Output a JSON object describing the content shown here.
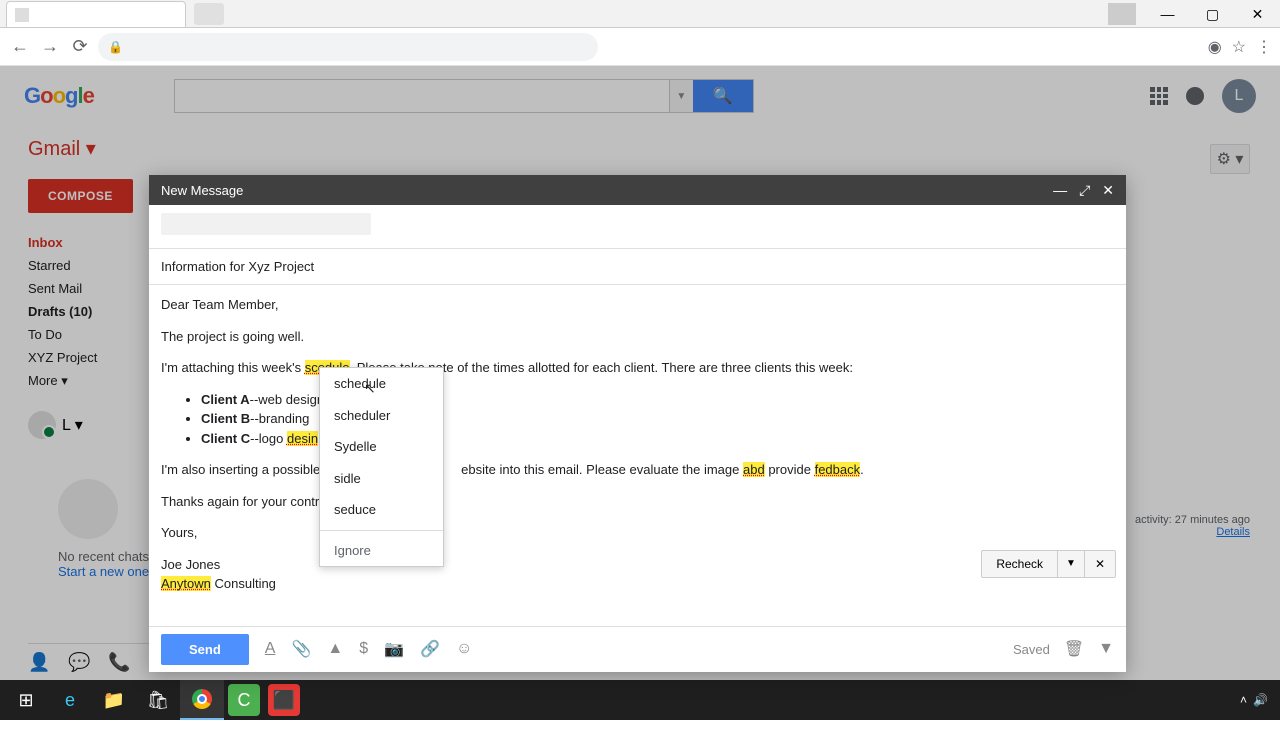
{
  "browser": {
    "window_controls": {
      "minimize": "—",
      "maximize": "▢",
      "close": "✕"
    }
  },
  "google": {
    "logo": "Google",
    "apps": "Apps",
    "avatar_letter": "L"
  },
  "gmail": {
    "title": "Gmail ▾",
    "compose": "COMPOSE",
    "nav": [
      "Inbox",
      "Starred",
      "Sent Mail",
      "Drafts (10)",
      "To Do",
      "XYZ Project",
      "More ▾"
    ],
    "user_letter": "L ▾",
    "hangouts_no_recent": "No recent chats",
    "hangouts_start": "Start a new one",
    "activity": "activity: 27 minutes ago",
    "details": "Details"
  },
  "compose": {
    "title": "New Message",
    "subject": "Information for Xyz Project",
    "body": {
      "greeting": "Dear Team Member,",
      "p1": "The project is going well.",
      "p2a": "I'm attaching this week's ",
      "p2_hl": "scedule",
      "p2b": ". Please take note of the times allotted for each client. There are three clients this week:",
      "clients": [
        {
          "name": "Client A",
          "desc": "--web design"
        },
        {
          "name": "Client B",
          "desc": "--branding"
        },
        {
          "name": "Client C",
          "desc": "--logo ",
          "hl": "desin"
        }
      ],
      "p3a": "I'm also inserting a possible ",
      "p3_gap": "                                      ",
      "p3b": "ebsite into this email. Please evaluate the image ",
      "p3_hl1": "abd",
      "p3c": " provide ",
      "p3_hl2": "fedback",
      "p3d": ".",
      "p4": "Thanks again for your contri",
      "p5": "Yours,",
      "sig1": "Joe Jones",
      "sig2_hl": "Anytown",
      "sig2b": " Consulting"
    },
    "spellcheck": {
      "suggestions": [
        "schedule",
        "scheduler",
        "Sydelle",
        "sidle",
        "seduce"
      ],
      "ignore": "Ignore"
    },
    "recheck": "Recheck",
    "send": "Send",
    "saved": "Saved"
  }
}
